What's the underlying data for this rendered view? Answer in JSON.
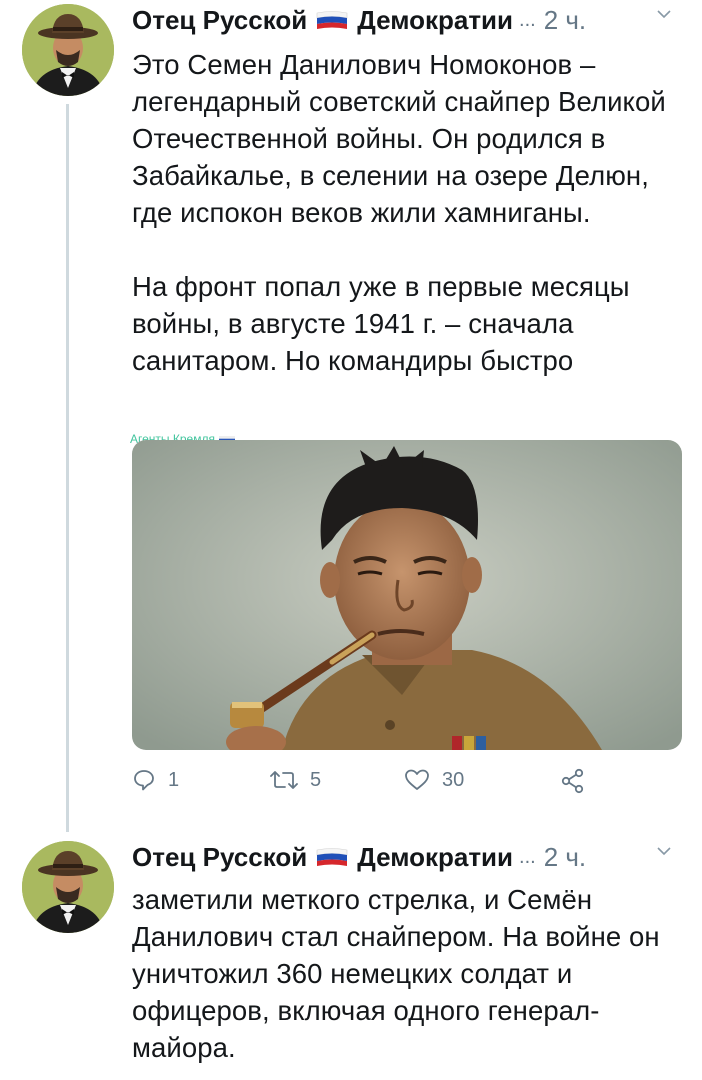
{
  "tweets": [
    {
      "author": "Отец Русской",
      "author_suffix": "Демократии",
      "ellipsis": "...",
      "time": "2 ч.",
      "paragraphs": [
        "Это Семен Данилович Номоконов – легендарный советский снайпер Великой Отечественной войны. Он родился в Забайкалье, в селении на озере Делюн, где испокон веков жили хамниганы.",
        "На фронт попал уже в первые месяцы войны, в августе 1941 г. – сначала санитаром. Но командиры быстро"
      ],
      "watermark": "Агенты Кремля",
      "actions": {
        "replies": "1",
        "retweets": "5",
        "likes": "30"
      }
    },
    {
      "author": "Отец Русской",
      "author_suffix": "Демократии",
      "ellipsis": "...",
      "time": "2 ч.",
      "paragraphs": [
        "заметили меткого стрелка, и Семён Данилович стал снайпером. На войне он уничтожил 360 немецких солдат и офицеров, включая одного генерал-майора."
      ]
    }
  ],
  "icons": {
    "reply": "reply-icon",
    "retweet": "retweet-icon",
    "like": "heart-icon",
    "share": "share-icon",
    "flag": "russian-flag-icon",
    "more": "chevron-down-icon"
  },
  "colors": {
    "text": "#14171a",
    "muted": "#657786",
    "thread": "#cfd9de",
    "watermark": "#43c59e"
  }
}
